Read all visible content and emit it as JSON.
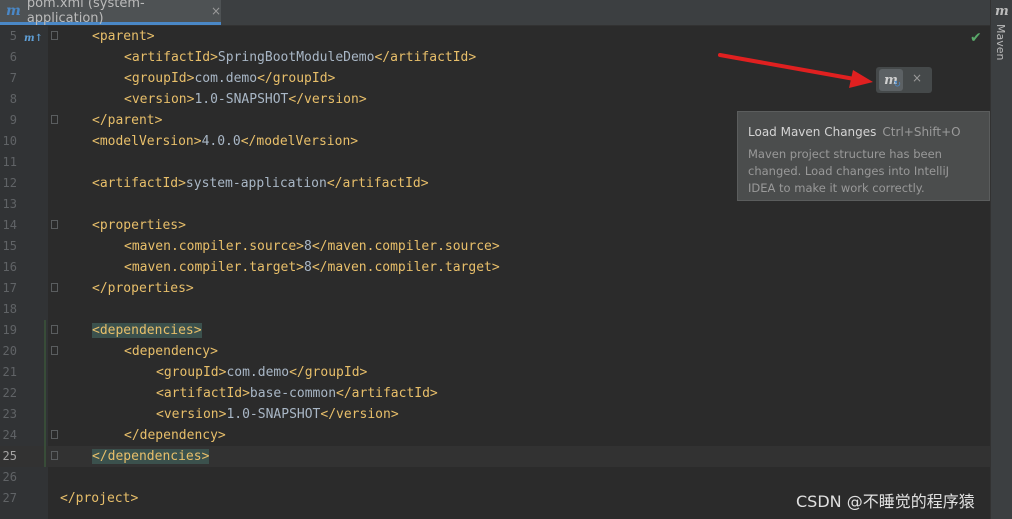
{
  "tab": {
    "icon": "maven-file-icon",
    "label": "pom.xml (system-application)",
    "close": "×"
  },
  "toolwindow": {
    "icon": "maven-icon",
    "label": "Maven"
  },
  "lines": [
    {
      "num": "5",
      "indent": 1,
      "parts": [
        [
          "tag",
          "<parent>"
        ]
      ]
    },
    {
      "num": "6",
      "indent": 2,
      "parts": [
        [
          "tag",
          "<artifactId>"
        ],
        [
          "txt",
          "SpringBootModuleDemo"
        ],
        [
          "tag",
          "</artifactId>"
        ]
      ]
    },
    {
      "num": "7",
      "indent": 2,
      "parts": [
        [
          "tag",
          "<groupId>"
        ],
        [
          "txt",
          "com.demo"
        ],
        [
          "tag",
          "</groupId>"
        ]
      ]
    },
    {
      "num": "8",
      "indent": 2,
      "parts": [
        [
          "tag",
          "<version>"
        ],
        [
          "txt",
          "1.0-SNAPSHOT"
        ],
        [
          "tag",
          "</version>"
        ]
      ]
    },
    {
      "num": "9",
      "indent": 1,
      "parts": [
        [
          "tag",
          "</parent>"
        ]
      ]
    },
    {
      "num": "10",
      "indent": 1,
      "parts": [
        [
          "tag",
          "<modelVersion>"
        ],
        [
          "txt",
          "4.0.0"
        ],
        [
          "tag",
          "</modelVersion>"
        ]
      ]
    },
    {
      "num": "11",
      "indent": 0,
      "parts": []
    },
    {
      "num": "12",
      "indent": 1,
      "parts": [
        [
          "tag",
          "<artifactId>"
        ],
        [
          "txt",
          "system-application"
        ],
        [
          "tag",
          "</artifactId>"
        ]
      ]
    },
    {
      "num": "13",
      "indent": 0,
      "parts": []
    },
    {
      "num": "14",
      "indent": 1,
      "parts": [
        [
          "tag",
          "<properties>"
        ]
      ]
    },
    {
      "num": "15",
      "indent": 2,
      "parts": [
        [
          "tag",
          "<maven.compiler.source>"
        ],
        [
          "txt",
          "8"
        ],
        [
          "tag",
          "</maven.compiler.source>"
        ]
      ]
    },
    {
      "num": "16",
      "indent": 2,
      "parts": [
        [
          "tag",
          "<maven.compiler.target>"
        ],
        [
          "txt",
          "8"
        ],
        [
          "tag",
          "</maven.compiler.target>"
        ]
      ]
    },
    {
      "num": "17",
      "indent": 1,
      "parts": [
        [
          "tag",
          "</properties>"
        ]
      ]
    },
    {
      "num": "18",
      "indent": 0,
      "parts": []
    },
    {
      "num": "19",
      "indent": 1,
      "parts": [
        [
          "hl",
          "<dependencies>"
        ]
      ]
    },
    {
      "num": "20",
      "indent": 2,
      "parts": [
        [
          "tag",
          "<dependency>"
        ]
      ]
    },
    {
      "num": "21",
      "indent": 3,
      "parts": [
        [
          "tag",
          "<groupId>"
        ],
        [
          "txt",
          "com.demo"
        ],
        [
          "tag",
          "</groupId>"
        ]
      ]
    },
    {
      "num": "22",
      "indent": 3,
      "parts": [
        [
          "tag",
          "<artifactId>"
        ],
        [
          "txt",
          "base-common"
        ],
        [
          "tag",
          "</artifactId>"
        ]
      ]
    },
    {
      "num": "23",
      "indent": 3,
      "parts": [
        [
          "tag",
          "<version>"
        ],
        [
          "txt",
          "1.0-SNAPSHOT"
        ],
        [
          "tag",
          "</version>"
        ]
      ]
    },
    {
      "num": "24",
      "indent": 2,
      "parts": [
        [
          "tag",
          "</dependency>"
        ]
      ]
    },
    {
      "num": "25",
      "indent": 1,
      "parts": [
        [
          "hl",
          "</dependencies>"
        ]
      ],
      "current": true
    },
    {
      "num": "26",
      "indent": 0,
      "parts": []
    },
    {
      "num": "27",
      "indent": 0,
      "parts": [
        [
          "tag",
          "</project>"
        ]
      ]
    }
  ],
  "status_icon": "✔",
  "float_toolbar": {
    "icon": "maven-reload-icon",
    "close": "×"
  },
  "tooltip": {
    "title": "Load Maven Changes",
    "shortcut": "Ctrl+Shift+O",
    "description": "Maven project structure has been changed. Load changes into IntelliJ IDEA to make it work correctly."
  },
  "watermark": "CSDN @不睡觉的程序猿",
  "colors": {
    "tag": "#e8bf6a",
    "text": "#a9b7c6",
    "arrow": "#e02020",
    "accent": "#4a88c7"
  }
}
